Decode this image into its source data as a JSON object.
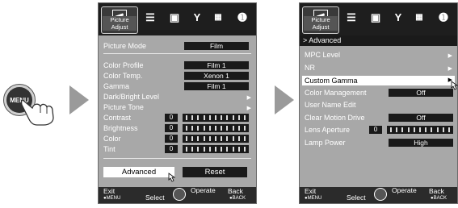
{
  "menu_button_label": "MENU",
  "screen1": {
    "tab_label": "Picture Adjust",
    "rows": [
      {
        "label": "Picture Mode",
        "value": "Film"
      },
      {
        "label": "Color Profile",
        "value": "Film 1"
      },
      {
        "label": "Color Temp.",
        "value": "Xenon 1"
      },
      {
        "label": "Gamma",
        "value": "Film 1"
      },
      {
        "label": "Dark/Bright Level",
        "value": ""
      },
      {
        "label": "Picture Tone",
        "value": ""
      },
      {
        "label": "Contrast",
        "value": "0"
      },
      {
        "label": "Brightness",
        "value": "0"
      },
      {
        "label": "Color",
        "value": "0"
      },
      {
        "label": "Tint",
        "value": "0"
      }
    ],
    "advanced_label": "Advanced",
    "reset_label": "Reset",
    "footer": {
      "exit": "Exit",
      "exit_key": "●MENU",
      "select": "Select",
      "operate": "Operate",
      "back": "Back",
      "back_key": "●BACK"
    }
  },
  "screen2": {
    "tab_label": "Picture Adjust",
    "breadcrumb": "> Advanced",
    "rows": [
      {
        "label": "MPC Level",
        "value": ""
      },
      {
        "label": "NR",
        "value": ""
      },
      {
        "label": "Custom Gamma",
        "value": ""
      },
      {
        "label": "Color Management",
        "value": "Off"
      },
      {
        "label": "User Name Edit",
        "value": ""
      },
      {
        "label": "Clear Motion Drive",
        "value": "Off"
      },
      {
        "label": "Lens Aperture",
        "value": "0"
      },
      {
        "label": "Lamp Power",
        "value": "High"
      }
    ],
    "footer": {
      "exit": "Exit",
      "exit_key": "●MENU",
      "select": "Select",
      "operate": "Operate",
      "back": "Back",
      "back_key": "●BACK"
    }
  },
  "colors": {
    "osd_bg": "#b3b3b3",
    "tabbar": "#1e1e1e",
    "value_box": "#1a1a1a",
    "highlight": "#ffffff",
    "arrow": "#9a9a9a"
  }
}
